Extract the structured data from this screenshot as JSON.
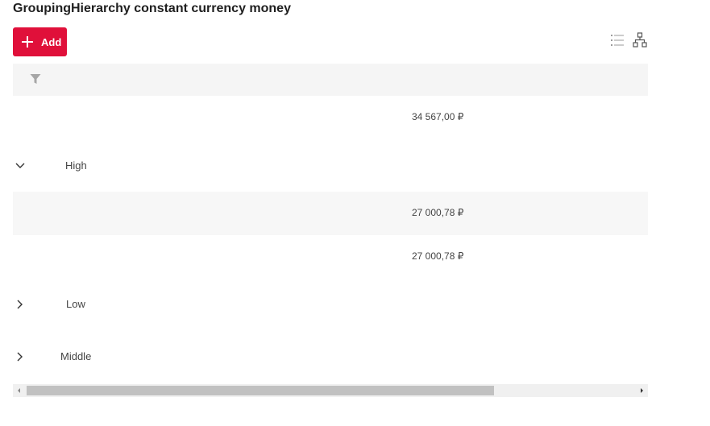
{
  "title": "GroupingHierarchy constant currency money",
  "toolbar": {
    "add_label": "Add"
  },
  "view_icons": [
    "list-icon",
    "hierarchy-icon"
  ],
  "rows": [
    {
      "type": "data",
      "value": "34 567,00 ₽"
    },
    {
      "type": "group",
      "label": "High",
      "expanded": true
    },
    {
      "type": "data",
      "value": "27 000,78 ₽"
    },
    {
      "type": "data",
      "value": "27 000,78 ₽"
    },
    {
      "type": "group",
      "label": "Low",
      "expanded": false
    },
    {
      "type": "group",
      "label": "Middle",
      "expanded": false
    }
  ],
  "scrollbar": {
    "position": 0,
    "visible_fraction": 0.74
  },
  "colors": {
    "accent": "#e0103a",
    "filter_bar": "#f5f5f5",
    "alt_row": "#f7f7f7",
    "scroll_thumb": "#c1c1c1"
  }
}
